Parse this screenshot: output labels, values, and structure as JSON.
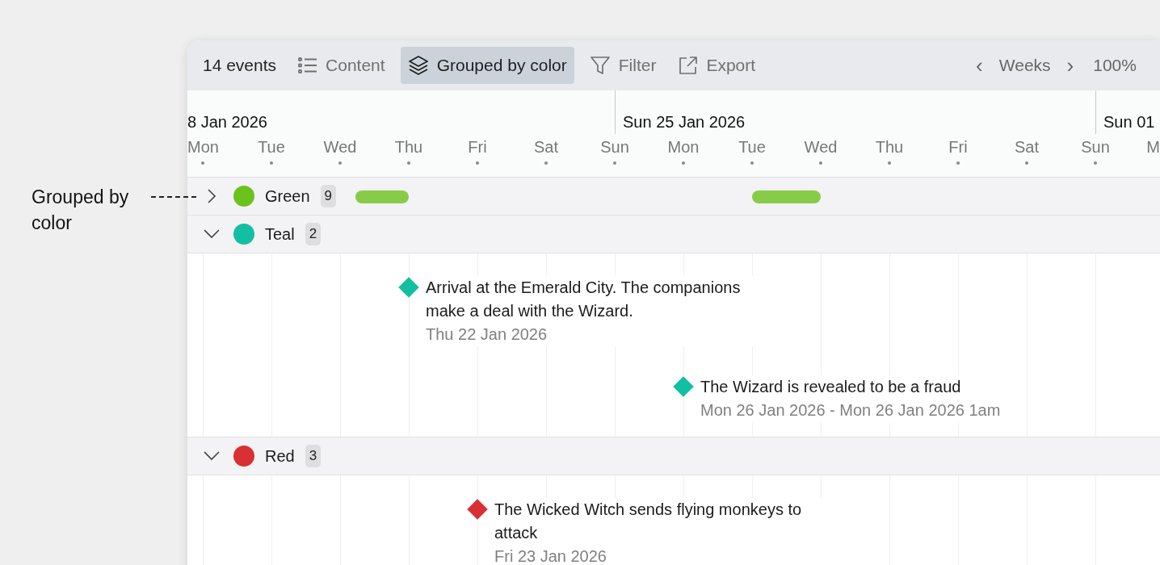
{
  "annotation": {
    "text": "Grouped by color"
  },
  "toolbar": {
    "count": "14 events",
    "tools": [
      {
        "kind": "list",
        "label": "Content",
        "selected": false
      },
      {
        "kind": "layers",
        "label": "Grouped by color",
        "selected": true
      },
      {
        "kind": "filter",
        "label": "Filter",
        "selected": false
      },
      {
        "kind": "export",
        "label": "Export",
        "selected": false
      }
    ],
    "prev": "‹",
    "scale": "Weeks",
    "next": "›",
    "zoom": "100%"
  },
  "weeks": [
    "8 Jan 2026",
    "Sun 25 Jan 2026",
    "Sun 01"
  ],
  "days": [
    "Mon",
    "Tue",
    "Wed",
    "Thu",
    "Fri",
    "Sat",
    "Sun",
    "Mon",
    "Tue",
    "Wed",
    "Thu",
    "Fri",
    "Sat",
    "Sun",
    "M"
  ],
  "groups": [
    {
      "name": "Green",
      "color": "#6cc21d",
      "count": "9",
      "expanded": false,
      "bars": [
        {
          "kind": "bar"
        },
        {
          "kind": "bar"
        }
      ]
    },
    {
      "name": "Teal",
      "color": "#12bfa2",
      "count": "2",
      "expanded": true,
      "events": [
        {
          "title": "Arrival at the Emerald City. The companions make a deal with the Wizard.",
          "date": "Thu 22 Jan 2026"
        },
        {
          "title": "The Wizard is revealed to be a fraud",
          "date": "Mon 26 Jan 2026 - Mon 26 Jan 2026 1am"
        }
      ]
    },
    {
      "name": "Red",
      "color": "#d93033",
      "count": "3",
      "expanded": true,
      "events": [
        {
          "title": "The Wicked Witch sends flying monkeys to attack",
          "date": "Fri 23 Jan 2026"
        }
      ]
    }
  ]
}
